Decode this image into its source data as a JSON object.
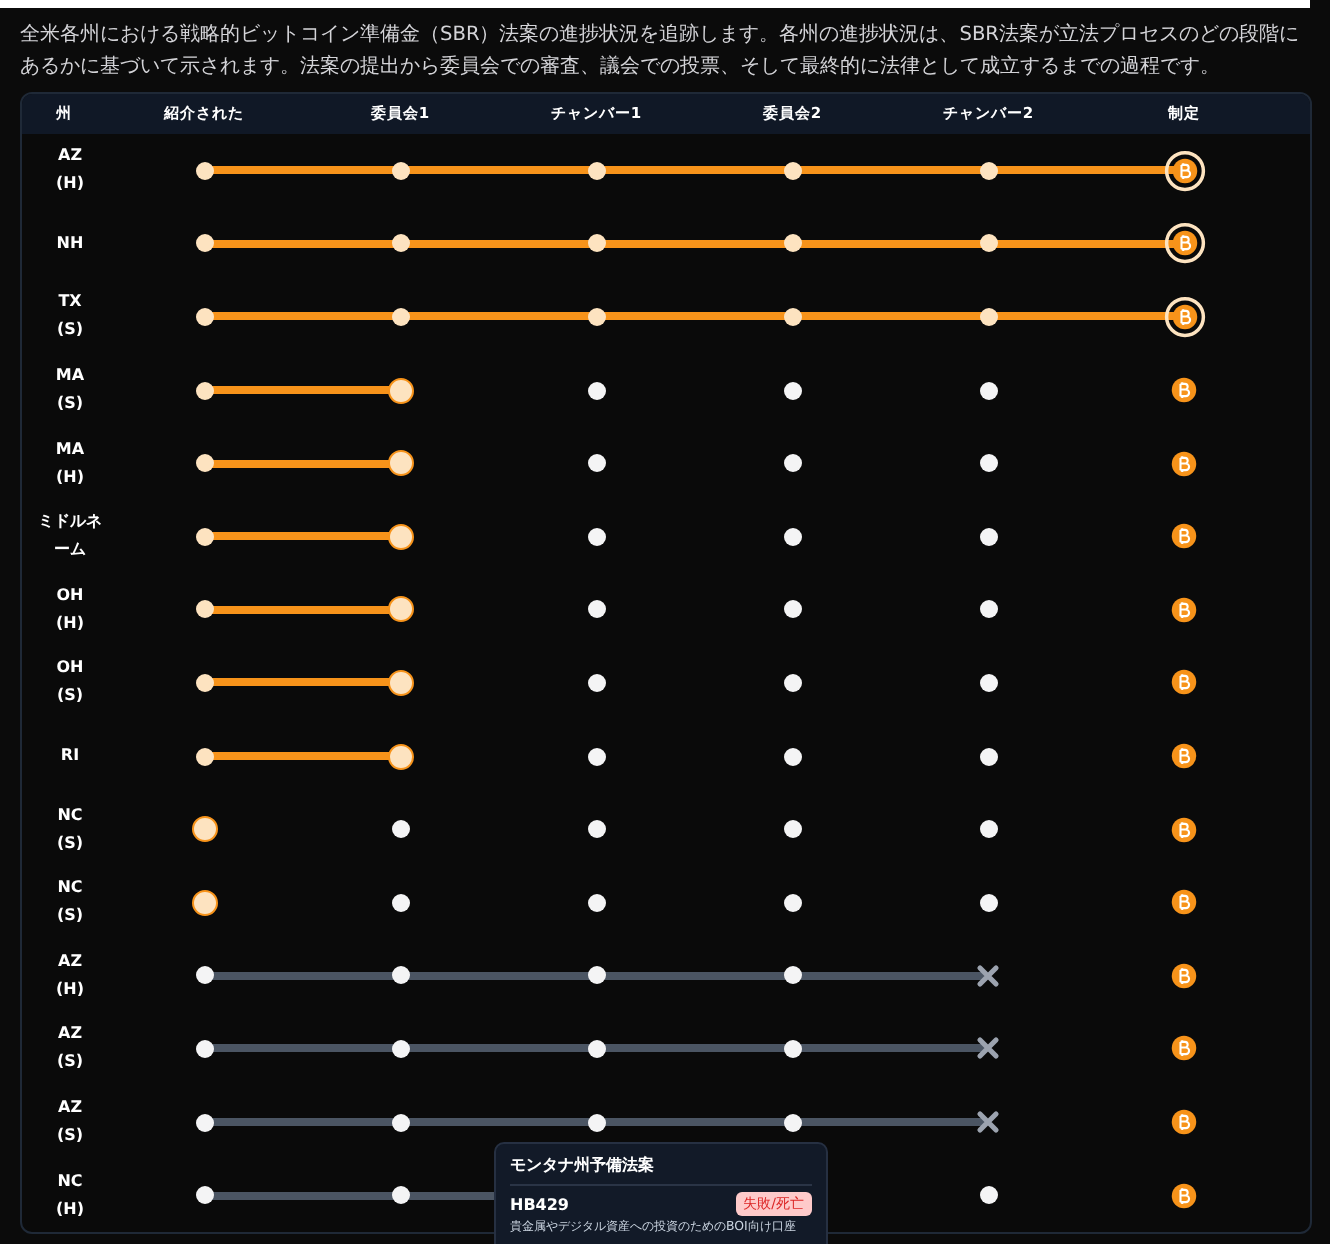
{
  "intro": "全米各州における戦略的ビットコイン準備金（SBR）法案の進捗状況を追跡します。各州の進捗状況は、SBR法案が立法プロセスのどの段階にあるかに基づいて示されます。法案の提出から委員会での審査、議会での投票、そして最終的に法律として成立するまでの過程です。",
  "columns": [
    "州",
    "紹介された",
    "委員会1",
    "チャンバー1",
    "委員会2",
    "チャンバー2",
    "制定"
  ],
  "rows": [
    {
      "state": "AZ",
      "chamber": "(H)",
      "dead": false,
      "stages": [
        {
          "kind": "passed"
        },
        {
          "kind": "passed"
        },
        {
          "kind": "passed"
        },
        {
          "kind": "passed"
        },
        {
          "kind": "passed"
        },
        {
          "kind": "current"
        }
      ]
    },
    {
      "state": "NH",
      "dead": false,
      "stages": [
        {
          "kind": "passed"
        },
        {
          "kind": "passed"
        },
        {
          "kind": "passed"
        },
        {
          "kind": "passed"
        },
        {
          "kind": "passed"
        },
        {
          "kind": "current"
        }
      ]
    },
    {
      "state": "TX",
      "chamber": "(S)",
      "dead": false,
      "stages": [
        {
          "kind": "passed"
        },
        {
          "kind": "passed"
        },
        {
          "kind": "passed"
        },
        {
          "kind": "passed"
        },
        {
          "kind": "passed"
        },
        {
          "kind": "current"
        }
      ]
    },
    {
      "state": "MA",
      "chamber": "(S)",
      "dead": false,
      "stages": [
        {
          "kind": "passed"
        },
        {
          "kind": "current"
        },
        {
          "kind": "pending"
        },
        {
          "kind": "pending"
        },
        {
          "kind": "pending"
        },
        {
          "kind": "pending"
        }
      ]
    },
    {
      "state": "MA",
      "chamber": "(H)",
      "dead": false,
      "stages": [
        {
          "kind": "passed"
        },
        {
          "kind": "current"
        },
        {
          "kind": "pending"
        },
        {
          "kind": "pending"
        },
        {
          "kind": "pending"
        },
        {
          "kind": "pending"
        }
      ]
    },
    {
      "state": "ミドルネーム",
      "dead": false,
      "stages": [
        {
          "kind": "passed"
        },
        {
          "kind": "current"
        },
        {
          "kind": "pending"
        },
        {
          "kind": "pending"
        },
        {
          "kind": "pending"
        },
        {
          "kind": "pending"
        }
      ]
    },
    {
      "state": "OH",
      "chamber": "(H)",
      "dead": false,
      "stages": [
        {
          "kind": "passed"
        },
        {
          "kind": "current"
        },
        {
          "kind": "pending"
        },
        {
          "kind": "pending"
        },
        {
          "kind": "pending"
        },
        {
          "kind": "pending"
        }
      ]
    },
    {
      "state": "OH",
      "chamber": "(S)",
      "dead": false,
      "stages": [
        {
          "kind": "passed"
        },
        {
          "kind": "current"
        },
        {
          "kind": "pending"
        },
        {
          "kind": "pending"
        },
        {
          "kind": "pending"
        },
        {
          "kind": "pending"
        }
      ]
    },
    {
      "state": "RI",
      "dead": false,
      "stages": [
        {
          "kind": "passed"
        },
        {
          "kind": "current"
        },
        {
          "kind": "pending"
        },
        {
          "kind": "pending"
        },
        {
          "kind": "pending"
        },
        {
          "kind": "pending"
        }
      ]
    },
    {
      "state": "NC",
      "chamber": "(S)",
      "dead": false,
      "stages": [
        {
          "kind": "current"
        },
        {
          "kind": "pending"
        },
        {
          "kind": "pending"
        },
        {
          "kind": "pending"
        },
        {
          "kind": "pending"
        },
        {
          "kind": "pending"
        }
      ]
    },
    {
      "state": "NC",
      "chamber": "(S)",
      "dead": false,
      "stages": [
        {
          "kind": "current"
        },
        {
          "kind": "pending"
        },
        {
          "kind": "pending"
        },
        {
          "kind": "pending"
        },
        {
          "kind": "pending"
        },
        {
          "kind": "pending"
        }
      ]
    },
    {
      "state": "AZ",
      "chamber": "(H)",
      "dead": true,
      "stages": [
        {
          "kind": "passed"
        },
        {
          "kind": "passed"
        },
        {
          "kind": "passed"
        },
        {
          "kind": "passed"
        },
        {
          "kind": "failed"
        },
        {
          "kind": "pending"
        }
      ]
    },
    {
      "state": "AZ",
      "chamber": "(S)",
      "dead": true,
      "stages": [
        {
          "kind": "passed"
        },
        {
          "kind": "passed"
        },
        {
          "kind": "passed"
        },
        {
          "kind": "passed"
        },
        {
          "kind": "failed"
        },
        {
          "kind": "pending"
        }
      ]
    },
    {
      "state": "AZ",
      "chamber": "(S)",
      "dead": true,
      "stages": [
        {
          "kind": "passed"
        },
        {
          "kind": "passed"
        },
        {
          "kind": "passed"
        },
        {
          "kind": "passed"
        },
        {
          "kind": "failed"
        },
        {
          "kind": "pending"
        }
      ]
    },
    {
      "state": "NC",
      "chamber": "(H)",
      "dead": true,
      "stages": [
        {
          "kind": "passed"
        },
        {
          "kind": "passed"
        },
        {
          "kind": "covered"
        },
        {
          "kind": "covered"
        },
        {
          "kind": "pending"
        },
        {
          "kind": "pending"
        }
      ]
    }
  ],
  "tooltip": {
    "title": "モンタナ州予備法案",
    "bill": "HB429",
    "badge": "失敗/死亡",
    "description": "貴金属やデジタル資産への投資のためのBOI向け口座"
  }
}
